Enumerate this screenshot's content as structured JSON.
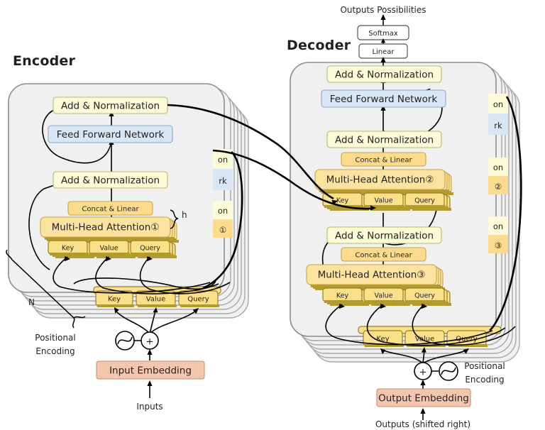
{
  "diagram": {
    "title_encoder": "Encoder",
    "title_decoder": "Decoder",
    "top_output_label": "Outputs Possibilities"
  },
  "encoder": {
    "stack_count_label": "N",
    "heads_label": "h",
    "add_norm_top": "Add & Normalization",
    "ffn": "Feed Forward Network",
    "add_norm_bottom": "Add & Normalization",
    "concat_linear": "Concat & Linear",
    "multi_head_attention": "Multi-Head Attention①",
    "key": "Key",
    "value": "Value",
    "query": "Query",
    "outer_key": "Key",
    "outer_value": "Value",
    "outer_query": "Query",
    "positional_encoding_line1": "Positional",
    "positional_encoding_line2": "Encoding",
    "plus": "+",
    "embedding": "Input Embedding",
    "inputs": "Inputs",
    "side_tabs": [
      {
        "text": "on",
        "kind": "on"
      },
      {
        "text": "rk",
        "kind": "rk"
      },
      {
        "text": "on",
        "kind": "on"
      },
      {
        "text": "①",
        "kind": "num"
      }
    ]
  },
  "decoder": {
    "softmax": "Softmax",
    "linear": "Linear",
    "add_norm_top": "Add & Normalization",
    "ffn": "Feed Forward Network",
    "add_norm_mid": "Add & Normalization",
    "concat_linear_mid": "Concat & Linear",
    "multi_head_attention_mid": "Multi-Head Attention②",
    "mid_key": "Key",
    "mid_value": "Value",
    "mid_query": "Query",
    "add_norm_bottom": "Add & Normalization",
    "concat_linear_bottom": "Concat & Linear",
    "multi_head_attention_bottom": "Multi-Head Attention③",
    "bot_key": "Key",
    "bot_value": "Value",
    "bot_query": "Query",
    "outer_key": "Key",
    "outer_value": "Value",
    "outer_query": "Query",
    "positional_encoding_line1": "Positional",
    "positional_encoding_line2": "Encoding",
    "plus": "+",
    "embedding": "Output Embedding",
    "outputs": "Outputs (shifted right)",
    "side_tabs": [
      {
        "text": "on",
        "kind": "on"
      },
      {
        "text": "rk",
        "kind": "rk"
      },
      {
        "text": "on",
        "kind": "on"
      },
      {
        "text": "②",
        "kind": "num"
      },
      {
        "text": "on",
        "kind": "on"
      },
      {
        "text": "③",
        "kind": "num"
      }
    ]
  },
  "colors": {
    "panel": "#f0f0f0",
    "add_norm": "#fbfbd8",
    "ffn": "#d9e6f5",
    "concat": "#fcdc8c",
    "mha": "#fde3a0",
    "kvq": "#fbe08a",
    "embedding": "#f4c6ad",
    "stroke": "#000000"
  }
}
